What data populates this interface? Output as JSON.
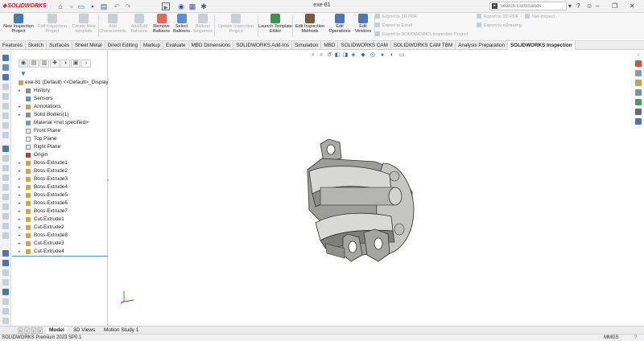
{
  "app": {
    "title": "exe-81",
    "logo_text": "SOLIDWORKS",
    "search_placeholder": "Search Commands"
  },
  "ribbon": {
    "buttons": [
      {
        "label": "New Inspection Project",
        "enabled": true
      },
      {
        "label": "Edit Inspection Project",
        "enabled": false
      },
      {
        "label": "Create New template",
        "enabled": false
      },
      {
        "label": "Add Characteristic",
        "enabled": false
      },
      {
        "label": "Add/Edit Balloons",
        "enabled": false
      },
      {
        "label": "Remove Balloons",
        "enabled": true
      },
      {
        "label": "Select Balloons",
        "enabled": true
      },
      {
        "label": "Balloon Sequence",
        "enabled": false
      },
      {
        "label": "Update Inspection Project",
        "enabled": false
      },
      {
        "label": "Launch Template Editor",
        "enabled": true
      },
      {
        "label": "Edit Inspection Methods",
        "enabled": true
      },
      {
        "label": "Edit Operations",
        "enabled": true
      },
      {
        "label": "Edit Vendors",
        "enabled": true
      }
    ],
    "export": {
      "export_2d_pdf": "Export to 2D PDF",
      "export_excel": "Export to Excel",
      "export_sw_project": "Export to SOLIDWORKS Inspection Project",
      "export_3d_pdf": "Export to 3D PDF",
      "export_edrawing": "Export to eDrawing",
      "net_inspect": "Net-Inspect"
    }
  },
  "tabs": [
    {
      "label": "Features",
      "active": false
    },
    {
      "label": "Sketch",
      "active": false
    },
    {
      "label": "Surfaces",
      "active": false
    },
    {
      "label": "Sheet Metal",
      "active": false
    },
    {
      "label": "Direct Editing",
      "active": false
    },
    {
      "label": "Markup",
      "active": false
    },
    {
      "label": "Evaluate",
      "active": false
    },
    {
      "label": "MBD Dimensions",
      "active": false
    },
    {
      "label": "SOLIDWORKS Add-Ins",
      "active": false
    },
    {
      "label": "Simulation",
      "active": false
    },
    {
      "label": "MBD",
      "active": false
    },
    {
      "label": "SOLIDWORKS CAM",
      "active": false
    },
    {
      "label": "SOLIDWORKS CAM TBM",
      "active": false
    },
    {
      "label": "Analysis Preparation",
      "active": false
    },
    {
      "label": "SOLIDWORKS Inspection",
      "active": true
    }
  ],
  "feature_tree": {
    "root": "exe-81 (Default) <<Default>_Display",
    "items": [
      {
        "label": "History",
        "expandable": true,
        "icon": "history-icon"
      },
      {
        "label": "Sensors",
        "expandable": false,
        "icon": "sensor-icon"
      },
      {
        "label": "Annotations",
        "expandable": true,
        "icon": "annotation-icon"
      },
      {
        "label": "Solid Bodies(1)",
        "expandable": true,
        "icon": "solid-bodies-icon"
      },
      {
        "label": "Material <not specified>",
        "expandable": false,
        "icon": "material-icon"
      },
      {
        "label": "Front Plane",
        "expandable": false,
        "icon": "plane-icon"
      },
      {
        "label": "Top Plane",
        "expandable": false,
        "icon": "plane-icon"
      },
      {
        "label": "Right Plane",
        "expandable": false,
        "icon": "plane-icon"
      },
      {
        "label": "Origin",
        "expandable": false,
        "icon": "origin-icon"
      },
      {
        "label": "Boss-Extrude1",
        "expandable": true,
        "icon": "boss-extrude-icon"
      },
      {
        "label": "Boss-Extrude2",
        "expandable": true,
        "icon": "boss-extrude-icon"
      },
      {
        "label": "Boss-Extrude3",
        "expandable": true,
        "icon": "boss-extrude-icon"
      },
      {
        "label": "Boss-Extrude4",
        "expandable": true,
        "icon": "boss-extrude-icon"
      },
      {
        "label": "Boss-Extrude5",
        "expandable": true,
        "icon": "boss-extrude-icon"
      },
      {
        "label": "Boss-Extrude6",
        "expandable": true,
        "icon": "boss-extrude-icon"
      },
      {
        "label": "Boss-Extrude7",
        "expandable": true,
        "icon": "boss-extrude-icon"
      },
      {
        "label": "Cut-Extrude1",
        "expandable": true,
        "icon": "cut-extrude-icon"
      },
      {
        "label": "Cut-Extrude2",
        "expandable": true,
        "icon": "cut-extrude-icon"
      },
      {
        "label": "Boss-Extrude8",
        "expandable": true,
        "icon": "boss-extrude-icon"
      },
      {
        "label": "Cut-Extrude3",
        "expandable": true,
        "icon": "cut-extrude-icon"
      },
      {
        "label": "Cut-Extrude4",
        "expandable": true,
        "icon": "cut-extrude-icon"
      }
    ]
  },
  "bottom_tabs": [
    {
      "label": "Model",
      "active": true
    },
    {
      "label": "3D Views",
      "active": false
    },
    {
      "label": "Motion Study 1",
      "active": false
    }
  ],
  "status": {
    "left": "SOLIDWORKS Premium 2023 SP0.1",
    "units": "MMGS",
    "help": "?"
  },
  "colors": {
    "accent": "#3d74b8",
    "logo_red": "#d41e1e",
    "part_gray": "#b9b9b5"
  }
}
